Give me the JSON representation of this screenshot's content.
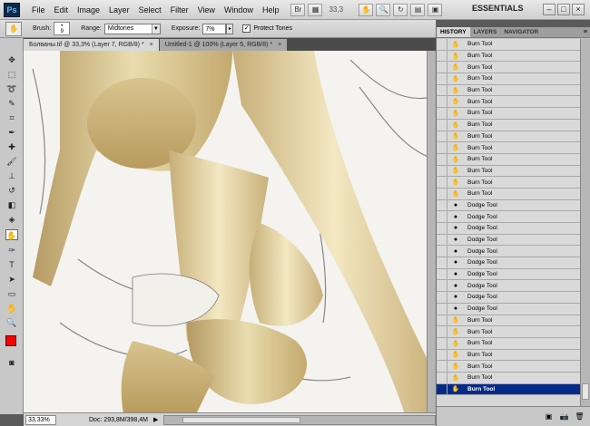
{
  "app": {
    "logo": "Ps"
  },
  "menu": [
    "File",
    "Edit",
    "Image",
    "Layer",
    "Select",
    "Filter",
    "View",
    "Window",
    "Help"
  ],
  "menu_tools": {
    "zoom_value": "33,3",
    "workspace": "ESSENTIALS",
    "win_min": "–",
    "win_max": "□",
    "win_close": "×"
  },
  "options": {
    "brush_label": "Brush:",
    "brush_size": "9",
    "range_label": "Range:",
    "range_value": "Midtones",
    "exposure_label": "Exposure:",
    "exposure_value": "7%",
    "protect_tones_label": "Protect Tones",
    "protect_tones_checked": true
  },
  "tabs": [
    {
      "label": "Болваны.tif @ 33,3% (Layer 7, RGB/8) *",
      "active": true
    },
    {
      "label": "Untitled-1 @ 100% (Layer 5, RGB/8) *",
      "active": false
    }
  ],
  "colors": {
    "foreground": "#ff0000",
    "background": "#ffffff",
    "history_selected": "#062a88"
  },
  "status": {
    "zoom": "33,33%",
    "doc": "Doc: 293,8M/398,4M",
    "arrow": "▶"
  },
  "panel": {
    "tabs": [
      "HISTORY",
      "LAYERS",
      "NAVIGATOR"
    ],
    "menu_icon": "≡",
    "history": [
      {
        "label": "Burn Tool",
        "tool": "burn"
      },
      {
        "label": "Burn Tool",
        "tool": "burn"
      },
      {
        "label": "Burn Tool",
        "tool": "burn"
      },
      {
        "label": "Burn Tool",
        "tool": "burn"
      },
      {
        "label": "Burn Tool",
        "tool": "burn"
      },
      {
        "label": "Burn Tool",
        "tool": "burn"
      },
      {
        "label": "Burn Tool",
        "tool": "burn"
      },
      {
        "label": "Burn Tool",
        "tool": "burn"
      },
      {
        "label": "Burn Tool",
        "tool": "burn"
      },
      {
        "label": "Burn Tool",
        "tool": "burn"
      },
      {
        "label": "Burn Tool",
        "tool": "burn"
      },
      {
        "label": "Burn Tool",
        "tool": "burn"
      },
      {
        "label": "Burn Tool",
        "tool": "burn"
      },
      {
        "label": "Burn Tool",
        "tool": "burn"
      },
      {
        "label": "Dodge Tool",
        "tool": "dodge"
      },
      {
        "label": "Dodge Tool",
        "tool": "dodge"
      },
      {
        "label": "Dodge Tool",
        "tool": "dodge"
      },
      {
        "label": "Dodge Tool",
        "tool": "dodge"
      },
      {
        "label": "Dodge Tool",
        "tool": "dodge"
      },
      {
        "label": "Dodge Tool",
        "tool": "dodge"
      },
      {
        "label": "Dodge Tool",
        "tool": "dodge"
      },
      {
        "label": "Dodge Tool",
        "tool": "dodge"
      },
      {
        "label": "Dodge Tool",
        "tool": "dodge"
      },
      {
        "label": "Dodge Tool",
        "tool": "dodge"
      },
      {
        "label": "Burn Tool",
        "tool": "burn"
      },
      {
        "label": "Burn Tool",
        "tool": "burn"
      },
      {
        "label": "Burn Tool",
        "tool": "burn"
      },
      {
        "label": "Burn Tool",
        "tool": "burn"
      },
      {
        "label": "Burn Tool",
        "tool": "burn"
      },
      {
        "label": "Burn Tool",
        "tool": "burn"
      },
      {
        "label": "Burn Tool",
        "tool": "burn",
        "selected": true
      }
    ]
  }
}
